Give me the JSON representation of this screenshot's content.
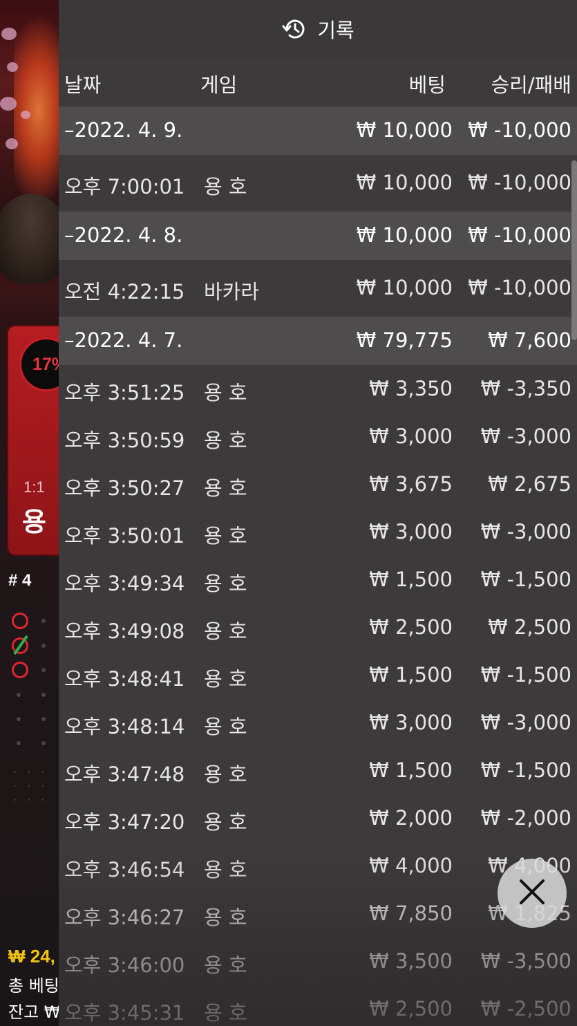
{
  "background": {
    "bet_card": {
      "percent": "17%",
      "odds": "1:1",
      "name": "용"
    },
    "round_number": "# 4",
    "balance_amount": "₩ 24,",
    "total_bet_label": "총 베팅",
    "balance_label": "잔고 ₩"
  },
  "history": {
    "title": "기록",
    "icon": "history-clock-icon",
    "columns": {
      "date": "날짜",
      "game": "게임",
      "bet": "베팅",
      "result": "승리/패배"
    },
    "rows": [
      {
        "type": "date",
        "datetime": "–2022. 4. 9.",
        "game": "",
        "bet": "₩ 10,000",
        "result": "₩ -10,000"
      },
      {
        "type": "entry",
        "datetime": "오후 7:00:01",
        "game": "용 호",
        "bet": "₩ 10,000",
        "result": "₩ -10,000"
      },
      {
        "type": "date",
        "datetime": "–2022. 4. 8.",
        "game": "",
        "bet": "₩ 10,000",
        "result": "₩ -10,000"
      },
      {
        "type": "entry",
        "datetime": "오전 4:22:15",
        "game": "바카라",
        "bet": "₩ 10,000",
        "result": "₩ -10,000"
      },
      {
        "type": "date",
        "datetime": "–2022. 4. 7.",
        "game": "",
        "bet": "₩ 79,775",
        "result": "₩ 7,600"
      },
      {
        "type": "entry",
        "datetime": "오후 3:51:25",
        "game": "용 호",
        "bet": "₩ 3,350",
        "result": "₩ -3,350"
      },
      {
        "type": "entry",
        "datetime": "오후 3:50:59",
        "game": "용 호",
        "bet": "₩ 3,000",
        "result": "₩ -3,000"
      },
      {
        "type": "entry",
        "datetime": "오후 3:50:27",
        "game": "용 호",
        "bet": "₩ 3,675",
        "result": "₩ 2,675"
      },
      {
        "type": "entry",
        "datetime": "오후 3:50:01",
        "game": "용 호",
        "bet": "₩ 3,000",
        "result": "₩ -3,000"
      },
      {
        "type": "entry",
        "datetime": "오후 3:49:34",
        "game": "용 호",
        "bet": "₩ 1,500",
        "result": "₩ -1,500"
      },
      {
        "type": "entry",
        "datetime": "오후 3:49:08",
        "game": "용 호",
        "bet": "₩ 2,500",
        "result": "₩ 2,500"
      },
      {
        "type": "entry",
        "datetime": "오후 3:48:41",
        "game": "용 호",
        "bet": "₩ 1,500",
        "result": "₩ -1,500"
      },
      {
        "type": "entry",
        "datetime": "오후 3:48:14",
        "game": "용 호",
        "bet": "₩ 3,000",
        "result": "₩ -3,000"
      },
      {
        "type": "entry",
        "datetime": "오후 3:47:48",
        "game": "용 호",
        "bet": "₩ 1,500",
        "result": "₩ -1,500"
      },
      {
        "type": "entry",
        "datetime": "오후 3:47:20",
        "game": "용 호",
        "bet": "₩ 2,000",
        "result": "₩ -2,000"
      },
      {
        "type": "entry",
        "datetime": "오후 3:46:54",
        "game": "용 호",
        "bet": "₩ 4,000",
        "result": "₩ 4,000"
      },
      {
        "type": "entry",
        "datetime": "오후 3:46:27",
        "game": "용 호",
        "bet": "₩ 7,850",
        "result": "₩ 1,825"
      },
      {
        "type": "entry",
        "datetime": "오후 3:46:00",
        "game": "용 호",
        "bet": "₩ 3,500",
        "result": "₩ -3,500"
      },
      {
        "type": "entry",
        "datetime": "오후 3:45:31",
        "game": "용 호",
        "bet": "₩ 2,500",
        "result": "₩ -2,500"
      }
    ],
    "close_icon": "close-icon"
  }
}
